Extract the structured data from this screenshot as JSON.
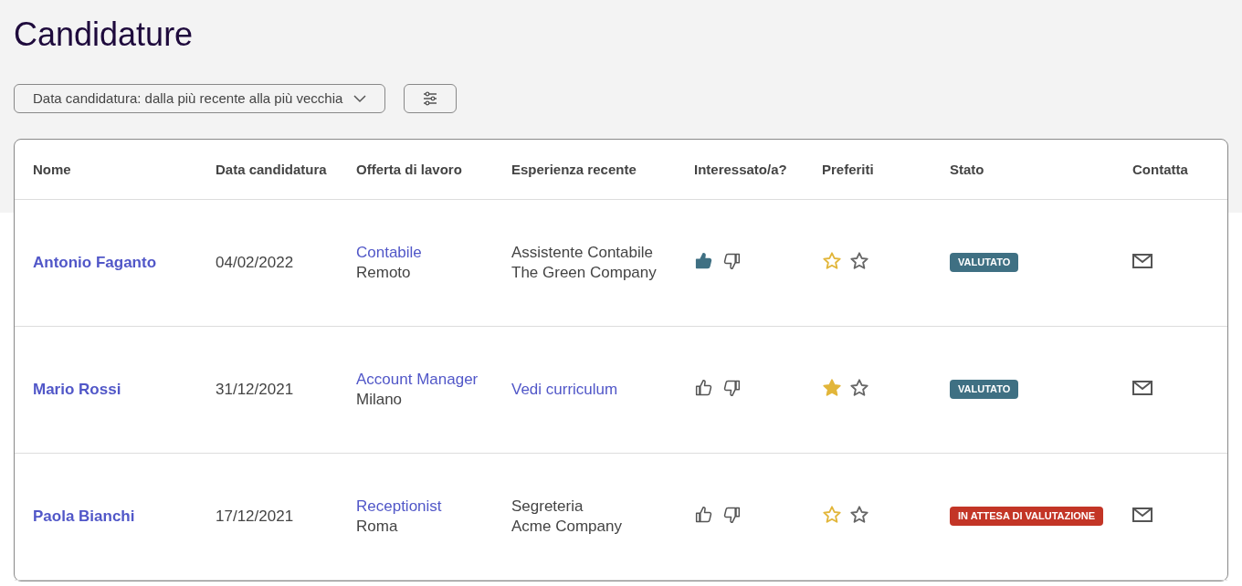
{
  "title": "Candidature",
  "sort": {
    "label": "Data candidatura: dalla più recente alla più vecchia"
  },
  "table": {
    "columns": [
      "Nome",
      "Data candidatura",
      "Offerta di lavoro",
      "Esperienza recente",
      "Interessato/a?",
      "Preferiti",
      "Stato",
      "Contatta"
    ],
    "rows": [
      {
        "name": "Antonio Faganto",
        "date": "04/02/2022",
        "job": "Contabile",
        "location": "Remoto",
        "experience": {
          "kind": "text",
          "lines": [
            "Assistente Contabile",
            "The Green Company"
          ]
        },
        "thumbs_up": true,
        "thumbs_down": false,
        "favorite": false,
        "status": {
          "label": "VALUTATO",
          "color": "#3f7083"
        }
      },
      {
        "name": "Mario Rossi",
        "date": "31/12/2021",
        "job": "Account Manager",
        "location": "Milano",
        "experience": {
          "kind": "link",
          "text": "Vedi curriculum"
        },
        "thumbs_up": false,
        "thumbs_down": false,
        "favorite": true,
        "status": {
          "label": "VALUTATO",
          "color": "#3f7083"
        }
      },
      {
        "name": "Paola Bianchi",
        "date": "17/12/2021",
        "job": "Receptionist",
        "location": "Roma",
        "experience": {
          "kind": "text",
          "lines": [
            "Segreteria",
            "Acme Company"
          ]
        },
        "thumbs_up": false,
        "thumbs_down": false,
        "favorite": false,
        "status": {
          "label": "IN ATTESA DI VALUTAZIONE",
          "color": "#c33526"
        }
      }
    ]
  }
}
